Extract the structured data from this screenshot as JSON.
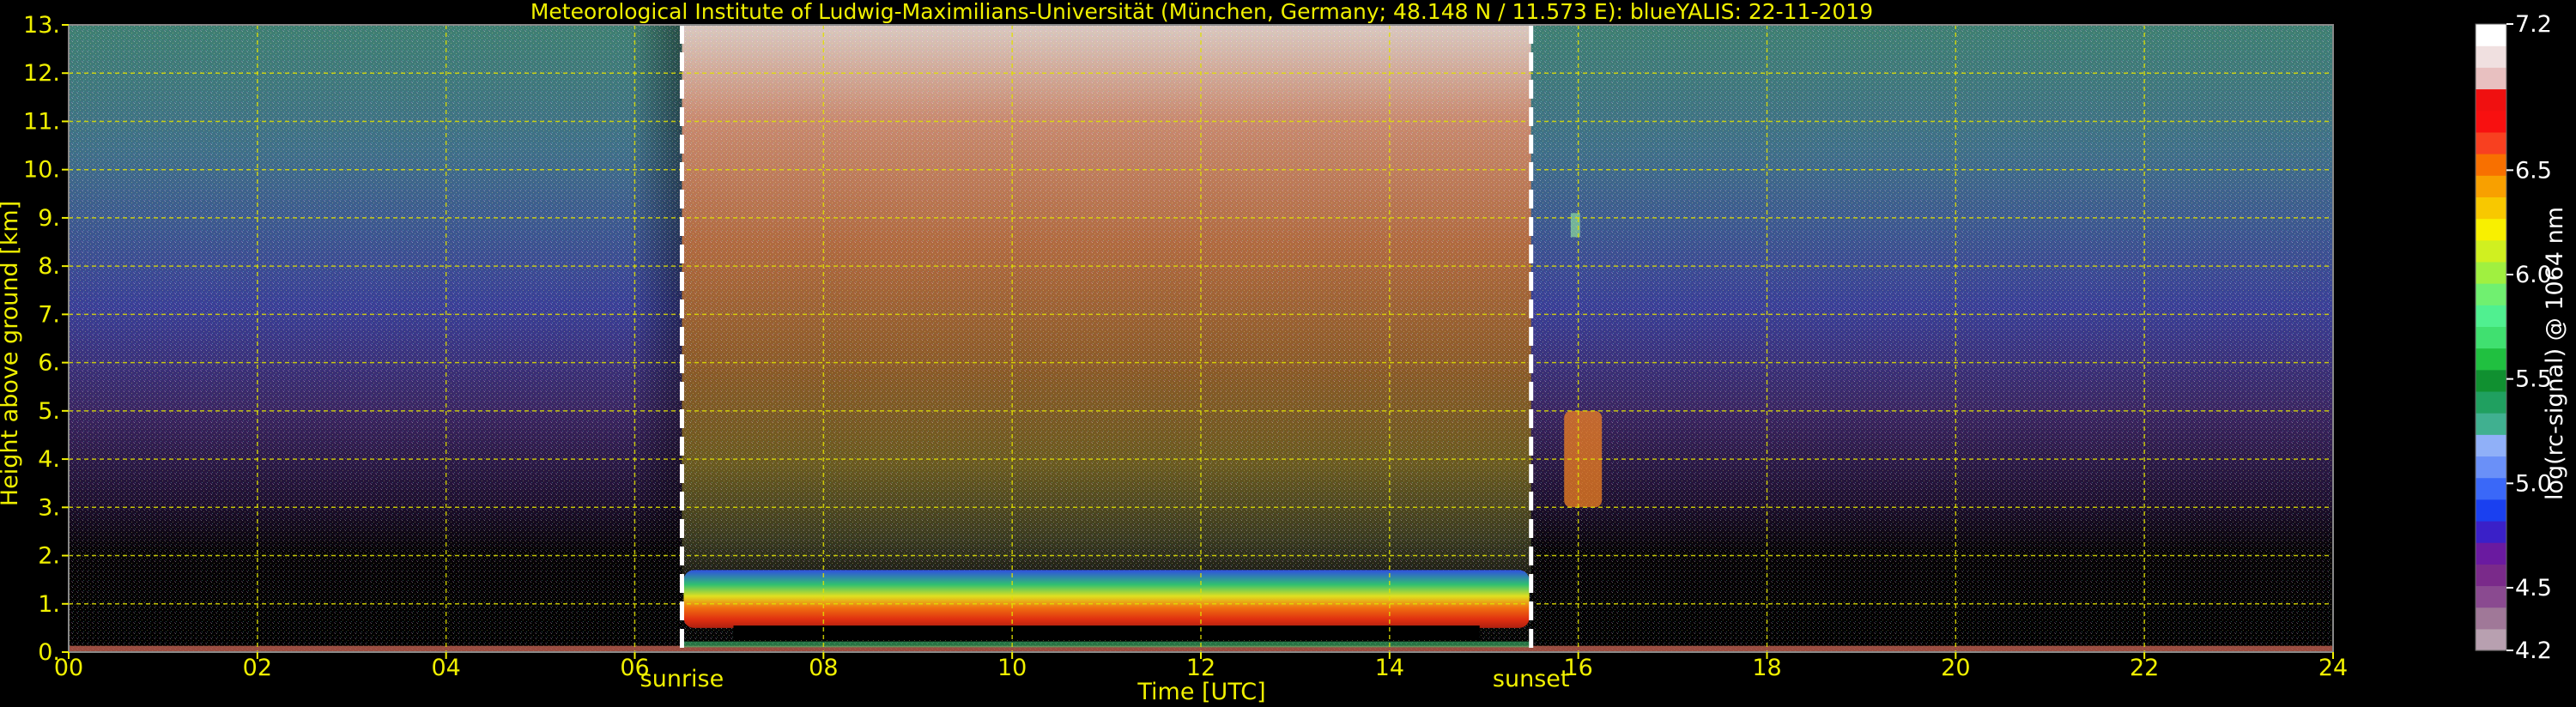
{
  "chart_data": {
    "type": "heatmap",
    "title": "Meteorological Institute of Ludwig-Maximilians-Universität (München, Germany; 48.148 N / 11.573 E):     blueYALIS: 22-11-2019",
    "xlabel": "Time [UTC]",
    "ylabel": "Height above ground [km]",
    "xlim": [
      0,
      24
    ],
    "ylim": [
      0,
      13
    ],
    "xticks": [
      "00",
      "02",
      "04",
      "06",
      "08",
      "10",
      "12",
      "14",
      "16",
      "18",
      "20",
      "22",
      "24"
    ],
    "yticks": [
      "0.",
      "1.",
      "2.",
      "3.",
      "4.",
      "5.",
      "6.",
      "7.",
      "8.",
      "9.",
      "10.",
      "11.",
      "12.",
      "13."
    ],
    "grid": true,
    "annotations": [
      {
        "label": "sunrise",
        "x": 6.5
      },
      {
        "label": "sunset",
        "x": 15.5
      }
    ],
    "colorbar": {
      "label": "log(rc-signal) @ 1064 nm",
      "range": [
        4.2,
        7.2
      ],
      "ticks": [
        "4.2",
        "4.5",
        "5.0",
        "5.5",
        "6.0",
        "6.5",
        "7.2"
      ],
      "colors": [
        "#b8a0b0",
        "#a07898",
        "#8a4a90",
        "#7a2a8a",
        "#6a1aa0",
        "#3a20c8",
        "#1a40f0",
        "#3a68f8",
        "#6a90f8",
        "#90b0f8",
        "#40b090",
        "#20a060",
        "#109030",
        "#20c040",
        "#40e070",
        "#50f090",
        "#70f070",
        "#a0f040",
        "#d0f020",
        "#f8f000",
        "#f8c800",
        "#f8a000",
        "#f87000",
        "#f84020",
        "#f81010",
        "#f01010",
        "#e8c0c0",
        "#f0e0e0",
        "#ffffff"
      ]
    }
  }
}
